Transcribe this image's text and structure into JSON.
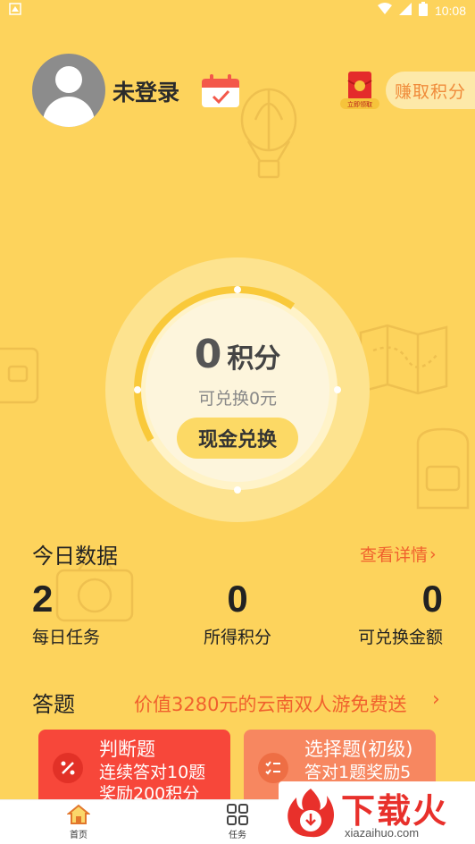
{
  "status_bar": {
    "time": "10:08",
    "notification_icon": "app-notification-icon",
    "wifi_icon": "wifi-icon",
    "signal_icon": "signal-icon",
    "battery_icon": "battery-icon"
  },
  "profile": {
    "username": "未登录",
    "avatar_icon": "avatar-placeholder-icon",
    "checkin_icon": "calendar-check-icon"
  },
  "header_right": {
    "redpacket_label": "立即领取",
    "earn_points_label": "赚取积分"
  },
  "points_panel": {
    "points_value": "0",
    "points_unit": "积分",
    "exchangeable_text": "可兑换0元",
    "cash_exchange_label": "现金兑换"
  },
  "today_data": {
    "title": "今日数据",
    "details_link": "查看详情",
    "stats": [
      {
        "value": "2",
        "label": "每日任务"
      },
      {
        "value": "0",
        "label": "所得积分"
      },
      {
        "value": "0",
        "label": "可兑换金额"
      }
    ]
  },
  "quiz": {
    "title": "答题",
    "promo": "价值3280元的云南双人游免费送",
    "cards": [
      {
        "title": "判断题",
        "line1": "连续答对10题",
        "line2": "奖励200积分"
      },
      {
        "title": "选择题(初级)",
        "line1": "答对1题奖励5",
        "line2": ""
      }
    ]
  },
  "bottom_nav": {
    "items": [
      {
        "label": "首页",
        "icon": "home-icon"
      },
      {
        "label": "任务",
        "icon": "grid-icon"
      }
    ]
  },
  "watermark": {
    "text": "下载火",
    "url": "xiazaihuo.com"
  },
  "colors": {
    "background": "#fdd35c",
    "accent_orange": "#f0612d",
    "card_red": "#f7473a",
    "card_orange": "#f78760"
  }
}
